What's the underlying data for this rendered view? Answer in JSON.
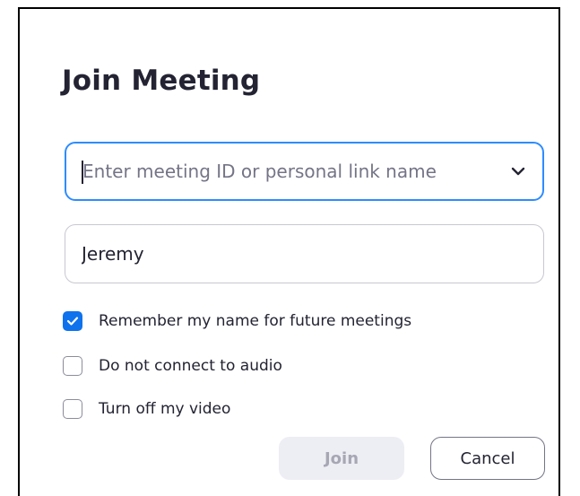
{
  "dialog": {
    "title": "Join Meeting"
  },
  "meeting_field": {
    "placeholder": "Enter meeting ID or personal link name",
    "value": "",
    "icon": "chevron-down-icon"
  },
  "name_field": {
    "value": "Jeremy"
  },
  "options": [
    {
      "label": "Remember my name for future meetings",
      "checked": true
    },
    {
      "label": "Do not connect to audio",
      "checked": false
    },
    {
      "label": "Turn off my video",
      "checked": false
    }
  ],
  "buttons": {
    "join_label": "Join",
    "join_enabled": false,
    "cancel_label": "Cancel"
  },
  "colors": {
    "accent": "#0e72ed",
    "focus_border": "#2d8cff",
    "text": "#232333",
    "disabled_bg": "#ededf4",
    "disabled_text": "#a7a7b4"
  }
}
